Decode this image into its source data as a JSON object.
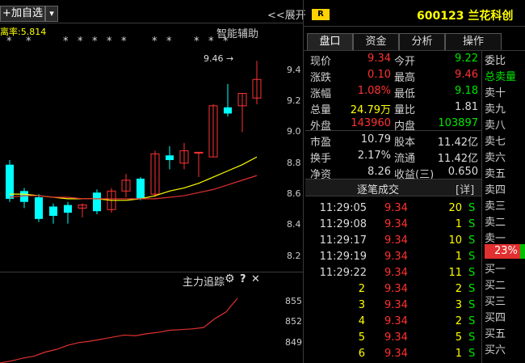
{
  "toolbar": {
    "add_watchlist_label": "+加自选",
    "dropdown_glyph": "▾",
    "collapse_label": "<<展开",
    "indicator_label": "离率:5.814",
    "smart_assist_label": "智能辅助",
    "stars": [
      "*",
      "*",
      "*",
      "*",
      "*",
      "*",
      "*",
      "*",
      "*",
      "*",
      "*",
      "*"
    ]
  },
  "price_chart": {
    "high_marker": "9.46",
    "y_ticks": [
      "9.4",
      "9.2",
      "9.0",
      "8.8",
      "8.6",
      "8.4",
      "8.2"
    ],
    "candles": [
      {
        "o": 8.79,
        "h": 8.82,
        "l": 8.55,
        "c": 8.57
      },
      {
        "o": 8.62,
        "h": 8.64,
        "l": 8.51,
        "c": 8.55
      },
      {
        "o": 8.58,
        "h": 8.6,
        "l": 8.42,
        "c": 8.44
      },
      {
        "o": 8.52,
        "h": 8.54,
        "l": 8.41,
        "c": 8.46
      },
      {
        "o": 8.53,
        "h": 8.55,
        "l": 8.41,
        "c": 8.48
      },
      {
        "o": 8.51,
        "h": 8.54,
        "l": 8.45,
        "c": 8.53
      },
      {
        "o": 8.61,
        "h": 8.63,
        "l": 8.47,
        "c": 8.49
      },
      {
        "o": 8.5,
        "h": 8.64,
        "l": 8.48,
        "c": 8.62
      },
      {
        "o": 8.62,
        "h": 8.73,
        "l": 8.58,
        "c": 8.69
      },
      {
        "o": 8.7,
        "h": 8.71,
        "l": 8.56,
        "c": 8.57
      },
      {
        "o": 8.6,
        "h": 8.88,
        "l": 8.58,
        "c": 8.86
      },
      {
        "o": 8.85,
        "h": 8.91,
        "l": 8.76,
        "c": 8.82
      },
      {
        "o": 8.8,
        "h": 8.93,
        "l": 8.76,
        "c": 8.88
      },
      {
        "o": 8.87,
        "h": 8.87,
        "l": 8.71,
        "c": 8.87
      },
      {
        "o": 8.84,
        "h": 9.18,
        "l": 8.84,
        "c": 9.17
      },
      {
        "o": 9.16,
        "h": 9.31,
        "l": 9.1,
        "c": 9.12
      },
      {
        "o": 9.17,
        "h": 9.25,
        "l": 9.0,
        "c": 9.25
      },
      {
        "o": 9.22,
        "h": 9.46,
        "l": 9.18,
        "c": 9.34
      }
    ],
    "ma_yellow": [
      8.6,
      8.6,
      8.59,
      8.58,
      8.57,
      8.57,
      8.57,
      8.56,
      8.56,
      8.57,
      8.59,
      8.62,
      8.64,
      8.67,
      8.71,
      8.75,
      8.79,
      8.84
    ],
    "ma_red": [
      8.58,
      8.59,
      8.59,
      8.58,
      8.58,
      8.57,
      8.57,
      8.57,
      8.57,
      8.57,
      8.57,
      8.58,
      8.59,
      8.61,
      8.63,
      8.66,
      8.69,
      8.72
    ]
  },
  "flow_panel": {
    "title": "主力追踪",
    "gear_icon": "gear-icon",
    "help_label": "?",
    "close_label": "✕",
    "y_ticks": [
      "855",
      "852",
      "849"
    ],
    "points": [
      846.0,
      846.3,
      846.7,
      847.0,
      847.6,
      848.0,
      848.6,
      849.0,
      849.2,
      849.5,
      849.8,
      850.1,
      850.0,
      850.3,
      850.5,
      850.8,
      850.9,
      851.0,
      851.2,
      852.5,
      853.5,
      855.5
    ]
  },
  "stock": {
    "badge": "R",
    "title": "600123 兰花科创"
  },
  "tabs": [
    "盘口",
    "资金",
    "分析",
    "操作"
  ],
  "quote_rows": [
    {
      "l1": "现价",
      "v1": "9.34",
      "c1": "red",
      "l2": "今开",
      "v2": "9.22",
      "c2": "grn"
    },
    {
      "l1": "涨跌",
      "v1": "0.10",
      "c1": "red",
      "l2": "最高",
      "v2": "9.46",
      "c2": "red"
    },
    {
      "l1": "涨幅",
      "v1": "1.08%",
      "c1": "red",
      "l2": "最低",
      "v2": "9.18",
      "c2": "grn"
    },
    {
      "l1": "总量",
      "v1": "24.79万",
      "c1": "yel",
      "l2": "量比",
      "v2": "1.81",
      "c2": "wht"
    },
    {
      "l1": "外盘",
      "v1": "143960",
      "c1": "red",
      "l2": "内盘",
      "v2": "103897",
      "c2": "grn"
    },
    {
      "l1": "市盈",
      "v1": "10.79",
      "c1": "wht",
      "l2": "股本",
      "v2": "11.42亿",
      "c2": "wht"
    },
    {
      "l1": "换手",
      "v1": "2.17%",
      "c1": "wht",
      "l2": "流通",
      "v2": "11.42亿",
      "c2": "wht"
    },
    {
      "l1": "净资",
      "v1": "8.26",
      "c1": "wht",
      "l2": "收益(三)",
      "v2": "0.650",
      "c2": "wht"
    }
  ],
  "trades_header": {
    "title": "逐笔成交",
    "detail": "[详]"
  },
  "trades": [
    {
      "t": "11:29:05",
      "p": "9.34",
      "v": "20",
      "s": "S"
    },
    {
      "t": "11:29:08",
      "p": "9.34",
      "v": "1",
      "s": "S"
    },
    {
      "t": "11:29:17",
      "p": "9.34",
      "v": "10",
      "s": "S"
    },
    {
      "t": "11:29:19",
      "p": "9.34",
      "v": "1",
      "s": "S"
    },
    {
      "t": "11:29:22",
      "p": "9.34",
      "v": "11",
      "s": "S"
    },
    {
      "t": "2",
      "p": "9.34",
      "v": "2",
      "s": "S"
    },
    {
      "t": "3",
      "p": "9.34",
      "v": "3",
      "s": "S"
    },
    {
      "t": "4",
      "p": "9.34",
      "v": "2",
      "s": "S"
    },
    {
      "t": "5",
      "p": "9.34",
      "v": "5",
      "s": "S"
    },
    {
      "t": "6",
      "p": "9.34",
      "v": "1",
      "s": "S"
    }
  ],
  "orderbook": {
    "wei_bi": "委比",
    "total_sell": "总卖量",
    "sell_levels": [
      "卖十",
      "卖九",
      "卖八",
      "卖七",
      "卖六",
      "卖五",
      "卖四",
      "卖三",
      "卖二",
      "卖一"
    ],
    "percent": "23%",
    "buy_levels": [
      "买一",
      "买二",
      "买三",
      "买四",
      "买五",
      "买六"
    ]
  },
  "colors": {
    "up": "#ff3232",
    "down": "#00e600",
    "cyan": "#00ffff",
    "yellow": "#ffff00"
  }
}
